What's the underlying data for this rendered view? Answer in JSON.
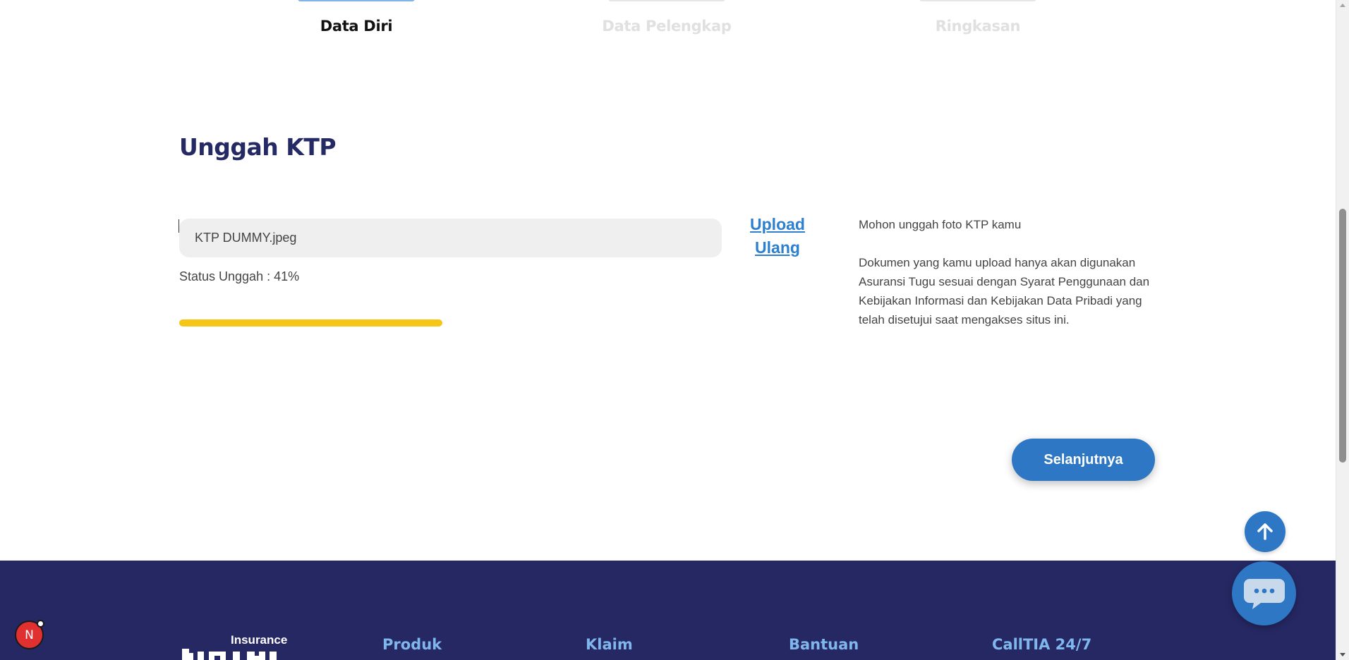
{
  "stepper": {
    "steps": [
      {
        "label": "Data Diri",
        "active": true
      },
      {
        "label": "Data Pelengkap",
        "active": false
      },
      {
        "label": "Ringkasan",
        "active": false
      }
    ]
  },
  "upload": {
    "title": "Unggah KTP",
    "file_name": "KTP DUMMY.jpeg",
    "status_text": "Status Unggah : 41%",
    "progress": 0.41,
    "reupload_label_line1": "Upload",
    "reupload_label_line2": "Ulang",
    "progress_color": "#f5c518"
  },
  "info": {
    "prompt": "Mohon unggah foto KTP kamu",
    "notice": "Dokumen yang kamu upload hanya akan digunakan Asuransi Tugu sesuai dengan Syarat Penggunaan dan Kebijakan Informasi dan Kebijakan Data Pribadi yang telah disetujui saat mengakses situs ini."
  },
  "actions": {
    "next_label": "Selanjutnya"
  },
  "footer": {
    "logo_text": "Insurance",
    "columns": [
      "Produk",
      "Klaim",
      "Bantuan",
      "CallTIA 24/7"
    ],
    "background": "#262864"
  },
  "floating": {
    "scroll_top_icon": "arrow-up-icon",
    "chat_icon": "chat-bubble-icon",
    "dev_badge_label": "N"
  },
  "theme": {
    "primary": "#2d77c4",
    "title_color": "#252a64",
    "footer_heading_color": "#7fb6ee"
  }
}
